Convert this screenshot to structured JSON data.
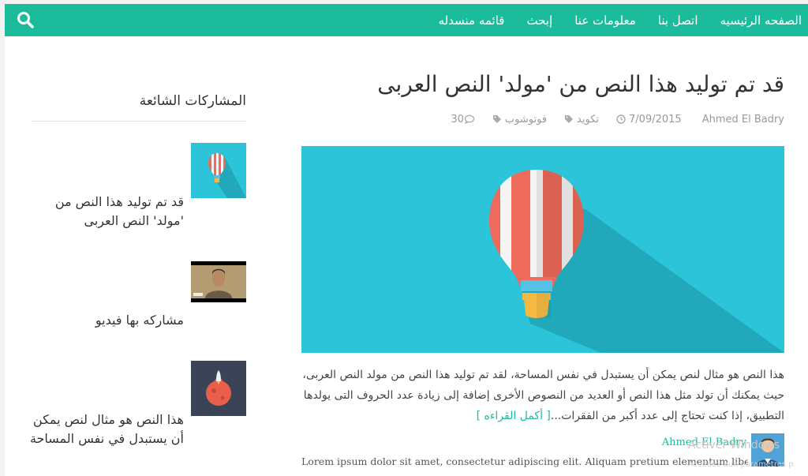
{
  "nav": {
    "items": [
      {
        "label": "الصفحه الرئيسيه"
      },
      {
        "label": "اتصل بنا"
      },
      {
        "label": "معلومات عنا"
      },
      {
        "label": "إبحث"
      },
      {
        "label": "قائمه منسدله"
      }
    ],
    "search_icon": "search-icon"
  },
  "post": {
    "title": "قد تم توليد هذا النص من 'مولد' النص العربى",
    "meta": {
      "author": "Ahmed El Badry",
      "date": "7/09/2015",
      "tags": [
        "تكويد",
        "فوتوشوب"
      ],
      "comments": "30"
    },
    "excerpt": "هذا النص هو مثال لنص يمكن أن يستبدل في نفس المساحة، لقد تم توليد هذا النص من مولد النص العربى، حيث يمكنك أن تولد مثل هذا النص أو العديد من النصوص الأخرى إضافة إلى زيادة عدد الحروف التى يولدها التطبيق، إذا كنت تحتاج إلى عدد أكبر من الفقرات...",
    "read_more": "[ أكمل القراءه ]",
    "author_name": "Ahmed El Badry",
    "lorem": "Lorem ipsum dolor sit amet, consectetur adipiscing elit. Aliquam pretium elementum libero, non"
  },
  "sidebar": {
    "title": "المشاركات الشائعة",
    "popular_posts": [
      {
        "title": "قد تم توليد هذا النص من 'مولد' النص العربى",
        "thumb": "balloon-thumbnail"
      },
      {
        "title": "مشاركه بها فيديو",
        "thumb": "video-thumbnail"
      },
      {
        "title": "هذا النص هو مثال لنص يمكن أن يستبدل في نفس المساحة",
        "thumb": "rocket-planet-thumbnail"
      }
    ]
  },
  "watermark": {
    "line1": "Activer Windows",
    "line2": "Accédez aux paramètres p"
  },
  "colors": {
    "accent": "#1abc9c",
    "hero_bg": "#2bc4d8"
  }
}
